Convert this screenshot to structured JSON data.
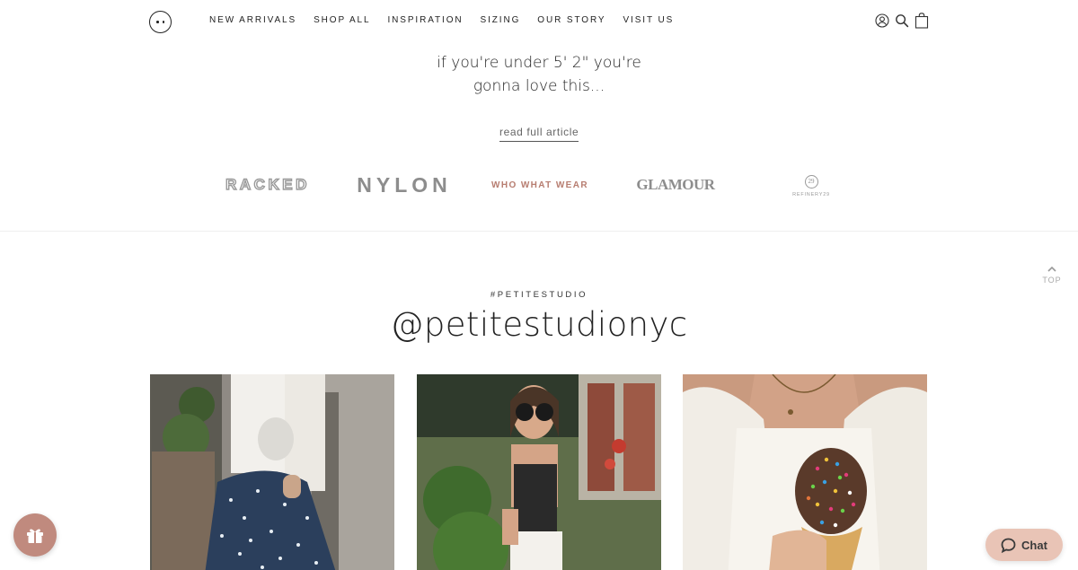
{
  "header": {
    "nav": [
      {
        "label": "NEW ARRIVALS"
      },
      {
        "label": "SHOP ALL"
      },
      {
        "label": "INSPIRATION"
      },
      {
        "label": "SIZING"
      },
      {
        "label": "OUR STORY"
      },
      {
        "label": "VISIT US"
      }
    ],
    "icons": [
      "account-icon",
      "search-icon",
      "cart-icon"
    ]
  },
  "press": {
    "quote_line1": "if you're under 5' 2\" you're",
    "quote_line2": "gonna love this...",
    "link_label": "read full article",
    "logos": [
      "RACKED",
      "NYLON",
      "WHO WHAT WEAR",
      "GLAMOUR",
      "REFINERY29"
    ],
    "r29_mark": "29"
  },
  "back_to_top": {
    "label": "TOP"
  },
  "instagram": {
    "hashtag": "#PETITESTUDIO",
    "handle": "@petitestudionyc"
  },
  "widgets": {
    "chat_label": "Chat"
  },
  "colors": {
    "accent_brand": "#b77d70",
    "gift_button": "#c08a7e",
    "chat_button": "#e9c4b6",
    "text": "#222222"
  }
}
